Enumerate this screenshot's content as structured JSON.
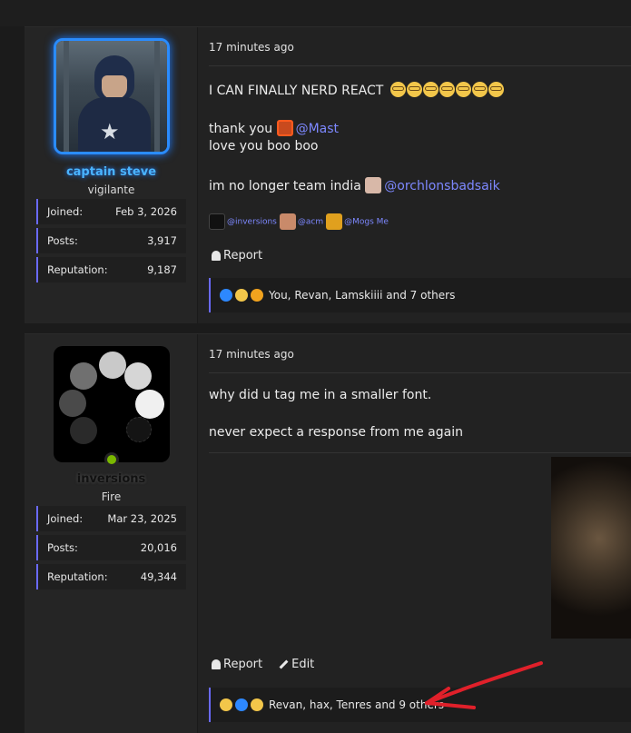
{
  "posts": [
    {
      "user": {
        "name": "captain steve",
        "title": "vigilante"
      },
      "stats": [
        {
          "label": "Joined:",
          "value": "Feb 3, 2026"
        },
        {
          "label": "Posts:",
          "value": "3,917"
        },
        {
          "label": "Reputation:",
          "value": "9,187"
        }
      ],
      "time": "17 minutes ago",
      "lines": {
        "l1": "I CAN FINALLY NERD REACT",
        "l2_prefix": "thank you",
        "l2_mention": "@Mast",
        "l3": "love you boo boo",
        "l4_prefix": "im no longer team india",
        "l4_mention": "@orchlonsbadsaik"
      },
      "tags": [
        "@inversions",
        "@acm",
        "@Mogs Me"
      ],
      "actions": {
        "report": "Report"
      },
      "reactions": {
        "text": "You, Revan, Lamskiiii and 7 others"
      }
    },
    {
      "user": {
        "name": "inversions",
        "title": "Fire"
      },
      "stats": [
        {
          "label": "Joined:",
          "value": "Mar 23, 2025"
        },
        {
          "label": "Posts:",
          "value": "20,016"
        },
        {
          "label": "Reputation:",
          "value": "49,344"
        }
      ],
      "time": "17 minutes ago",
      "lines": {
        "l1": "why did u tag me in a smaller font.",
        "l2": "never expect a response from me again"
      },
      "actions": {
        "report": "Report",
        "edit": "Edit"
      },
      "reactions": {
        "text": "Revan, hax, Tenres and 9 others"
      }
    }
  ],
  "colors": {
    "accent": "#6a6aff",
    "mention": "#7d88ff",
    "online": "#7ab800",
    "annotation": "#e0202a"
  }
}
